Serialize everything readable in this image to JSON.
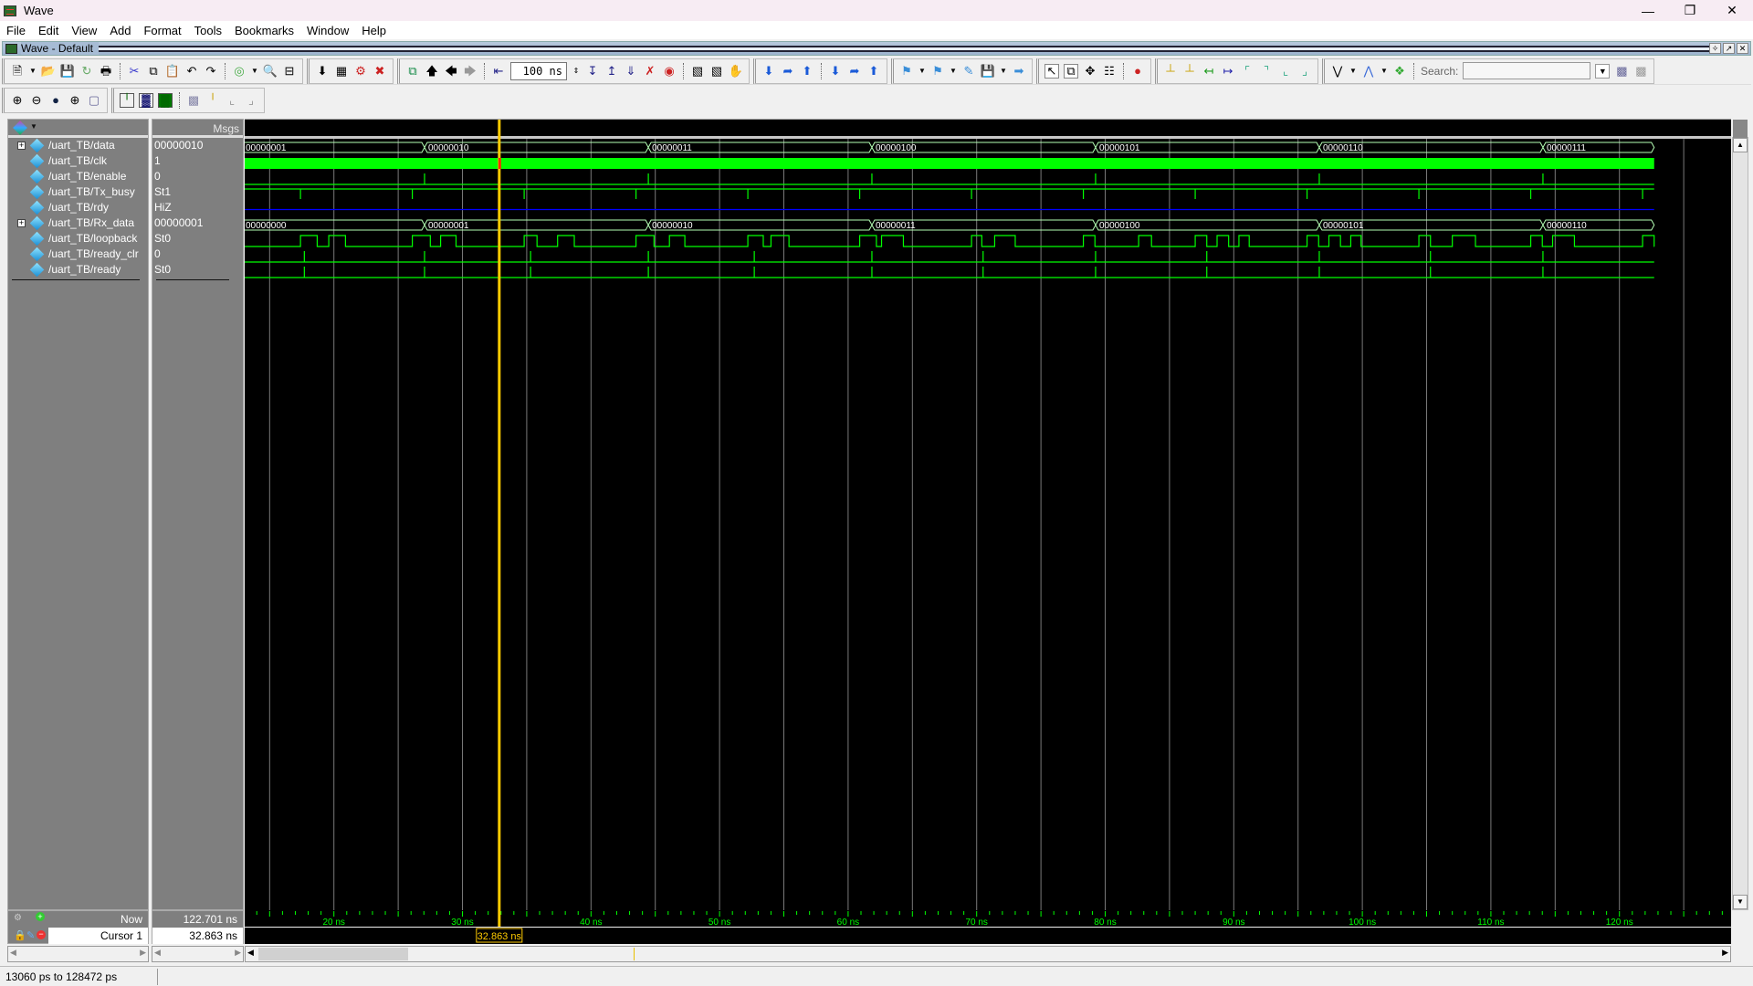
{
  "window": {
    "title": "Wave",
    "controls": [
      "minimize",
      "restore",
      "close"
    ]
  },
  "menu": [
    "File",
    "Edit",
    "View",
    "Add",
    "Format",
    "Tools",
    "Bookmarks",
    "Window",
    "Help"
  ],
  "subwindow": {
    "title": "Wave - Default"
  },
  "toolbar": {
    "zoom_value": "100 ns",
    "search_label": "Search:",
    "search_value": ""
  },
  "panes": {
    "values_header": "Msgs"
  },
  "signals": [
    {
      "name": "/uart_TB/data",
      "value": "00000010",
      "expandable": true,
      "type": "bus"
    },
    {
      "name": "/uart_TB/clk",
      "value": "1",
      "expandable": false,
      "type": "clock"
    },
    {
      "name": "/uart_TB/enable",
      "value": "0",
      "expandable": false,
      "type": "pulse"
    },
    {
      "name": "/uart_TB/Tx_busy",
      "value": "St1",
      "expandable": false,
      "type": "pulse-low"
    },
    {
      "name": "/uart_TB/rdy",
      "value": "HiZ",
      "expandable": false,
      "type": "hiz"
    },
    {
      "name": "/uart_TB/Rx_data",
      "value": "00000001",
      "expandable": true,
      "type": "bus"
    },
    {
      "name": "/uart_TB/loopback",
      "value": "St0",
      "expandable": false,
      "type": "serial"
    },
    {
      "name": "/uart_TB/ready_clr",
      "value": "0",
      "expandable": false,
      "type": "pulse"
    },
    {
      "name": "/uart_TB/ready",
      "value": "St0",
      "expandable": false,
      "type": "pulse"
    }
  ],
  "wave_data": {
    "view_start_ns": 13.06,
    "view_end_ns": 128.472,
    "end_ns": 122.701,
    "data_bus": {
      "times": [
        13.06,
        27.05,
        44.46,
        61.85,
        79.25,
        96.65,
        114.05
      ],
      "values": [
        "00000001",
        "00000010",
        "00000011",
        "00000100",
        "00000101",
        "00000110",
        "00000111"
      ]
    },
    "rx_bus": {
      "times": [
        13.06,
        27.05,
        44.46,
        61.85,
        79.25,
        96.65,
        114.05
      ],
      "values": [
        "00000000",
        "00000001",
        "00000010",
        "00000011",
        "00000100",
        "00000101",
        "00000110"
      ]
    },
    "enable_pulses": [
      27.05,
      44.46,
      61.85,
      79.25,
      96.65,
      114.05
    ],
    "tx_busy_dips": [
      17.4,
      26.1,
      34.8,
      43.5,
      52.2,
      60.9,
      69.6,
      78.3,
      87.0,
      95.7,
      104.4,
      113.1,
      121.8
    ],
    "loopback_highs": [
      [
        17.4,
        18.7
      ],
      [
        19.6,
        20.9
      ],
      [
        26.1,
        27.5
      ],
      [
        28.3,
        29.5
      ],
      [
        34.8,
        35.8
      ],
      [
        37.4,
        38.7
      ],
      [
        43.5,
        44.9
      ],
      [
        46.1,
        47.3
      ],
      [
        52.2,
        53.4
      ],
      [
        54.0,
        55.4
      ],
      [
        60.9,
        62.2
      ],
      [
        62.6,
        64.3
      ],
      [
        69.6,
        70.4
      ],
      [
        71.4,
        73.0
      ],
      [
        78.3,
        79.2
      ],
      [
        82.6,
        83.6
      ],
      [
        87.0,
        87.9
      ],
      [
        88.7,
        89.6
      ],
      [
        90.4,
        91.2
      ],
      [
        95.7,
        96.6
      ],
      [
        97.4,
        98.3
      ],
      [
        99.1,
        99.9
      ],
      [
        104.4,
        105.3
      ],
      [
        107.0,
        108.8
      ],
      [
        113.1,
        114.0
      ],
      [
        114.8,
        116.5
      ],
      [
        121.8,
        122.7
      ]
    ],
    "ready_clr_pulses": [
      17.7,
      27.05,
      35.3,
      44.46,
      52.7,
      61.85,
      70.5,
      79.25,
      87.9,
      96.65,
      105.3,
      114.05
    ],
    "ready_pulses": [
      17.7,
      27.05,
      35.3,
      44.46,
      52.7,
      61.85,
      70.5,
      79.25,
      87.9,
      96.65,
      105.3,
      114.05
    ],
    "grid_ns": [
      15,
      20,
      25,
      30,
      35,
      40,
      45,
      50,
      55,
      60,
      65,
      70,
      75,
      80,
      85,
      90,
      95,
      100,
      105,
      110,
      115,
      120,
      125
    ],
    "axis_labels": [
      "20 ns",
      "30 ns",
      "40 ns",
      "50 ns",
      "60 ns",
      "70 ns",
      "80 ns",
      "90 ns",
      "100 ns",
      "110 ns",
      "120 ns"
    ],
    "axis_label_ns": [
      20,
      30,
      40,
      50,
      60,
      70,
      80,
      90,
      100,
      110,
      120
    ]
  },
  "cursor": {
    "label": "Cursor 1",
    "value": "32.863 ns",
    "time_ns": 32.863,
    "color": "#ffcc00"
  },
  "now": {
    "label": "Now",
    "value": "122.701 ns"
  },
  "status": {
    "range": "13060 ps to 128472 ps"
  },
  "colors": {
    "signal": "#00ff00",
    "hiz": "#0000ff",
    "grid": "#808080",
    "bus_outline": "#b4ffb4"
  }
}
